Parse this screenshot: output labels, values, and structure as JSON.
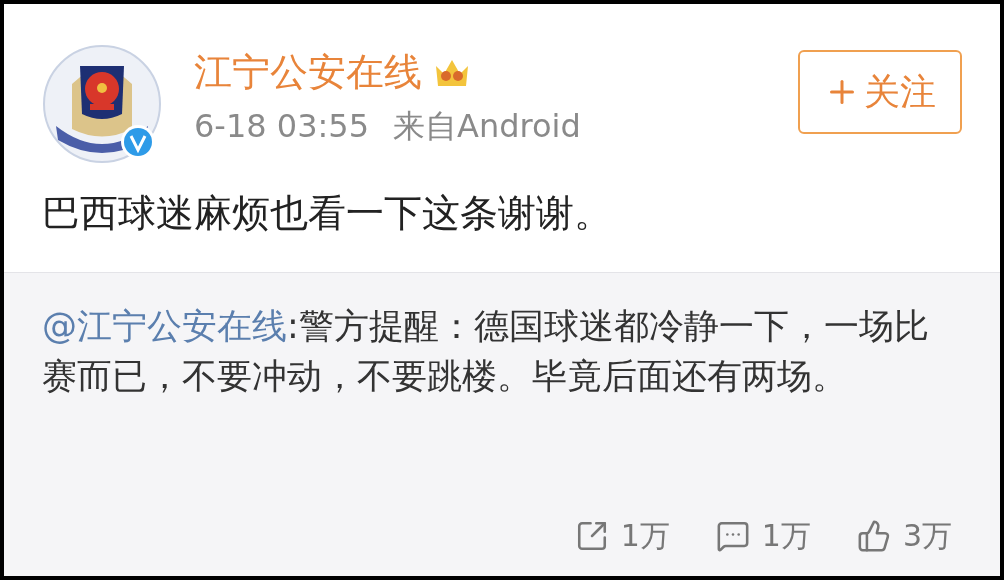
{
  "post": {
    "author": "江宁公安在线",
    "time": "6-18 03:55",
    "source": "来自Android",
    "follow_button": "关注",
    "text": "巴西球迷麻烦也看一下这条谢谢。"
  },
  "quoted": {
    "mention": "@江宁公安在线",
    "text": ":警方提醒：德国球迷都冷静一下，一场比赛而已，不要冲动，不要跳楼。毕竟后面还有两场。"
  },
  "actions": [
    {
      "kind": "repost",
      "count": "1万"
    },
    {
      "kind": "comment",
      "count": "1万"
    },
    {
      "kind": "like",
      "count": "3万"
    }
  ]
}
